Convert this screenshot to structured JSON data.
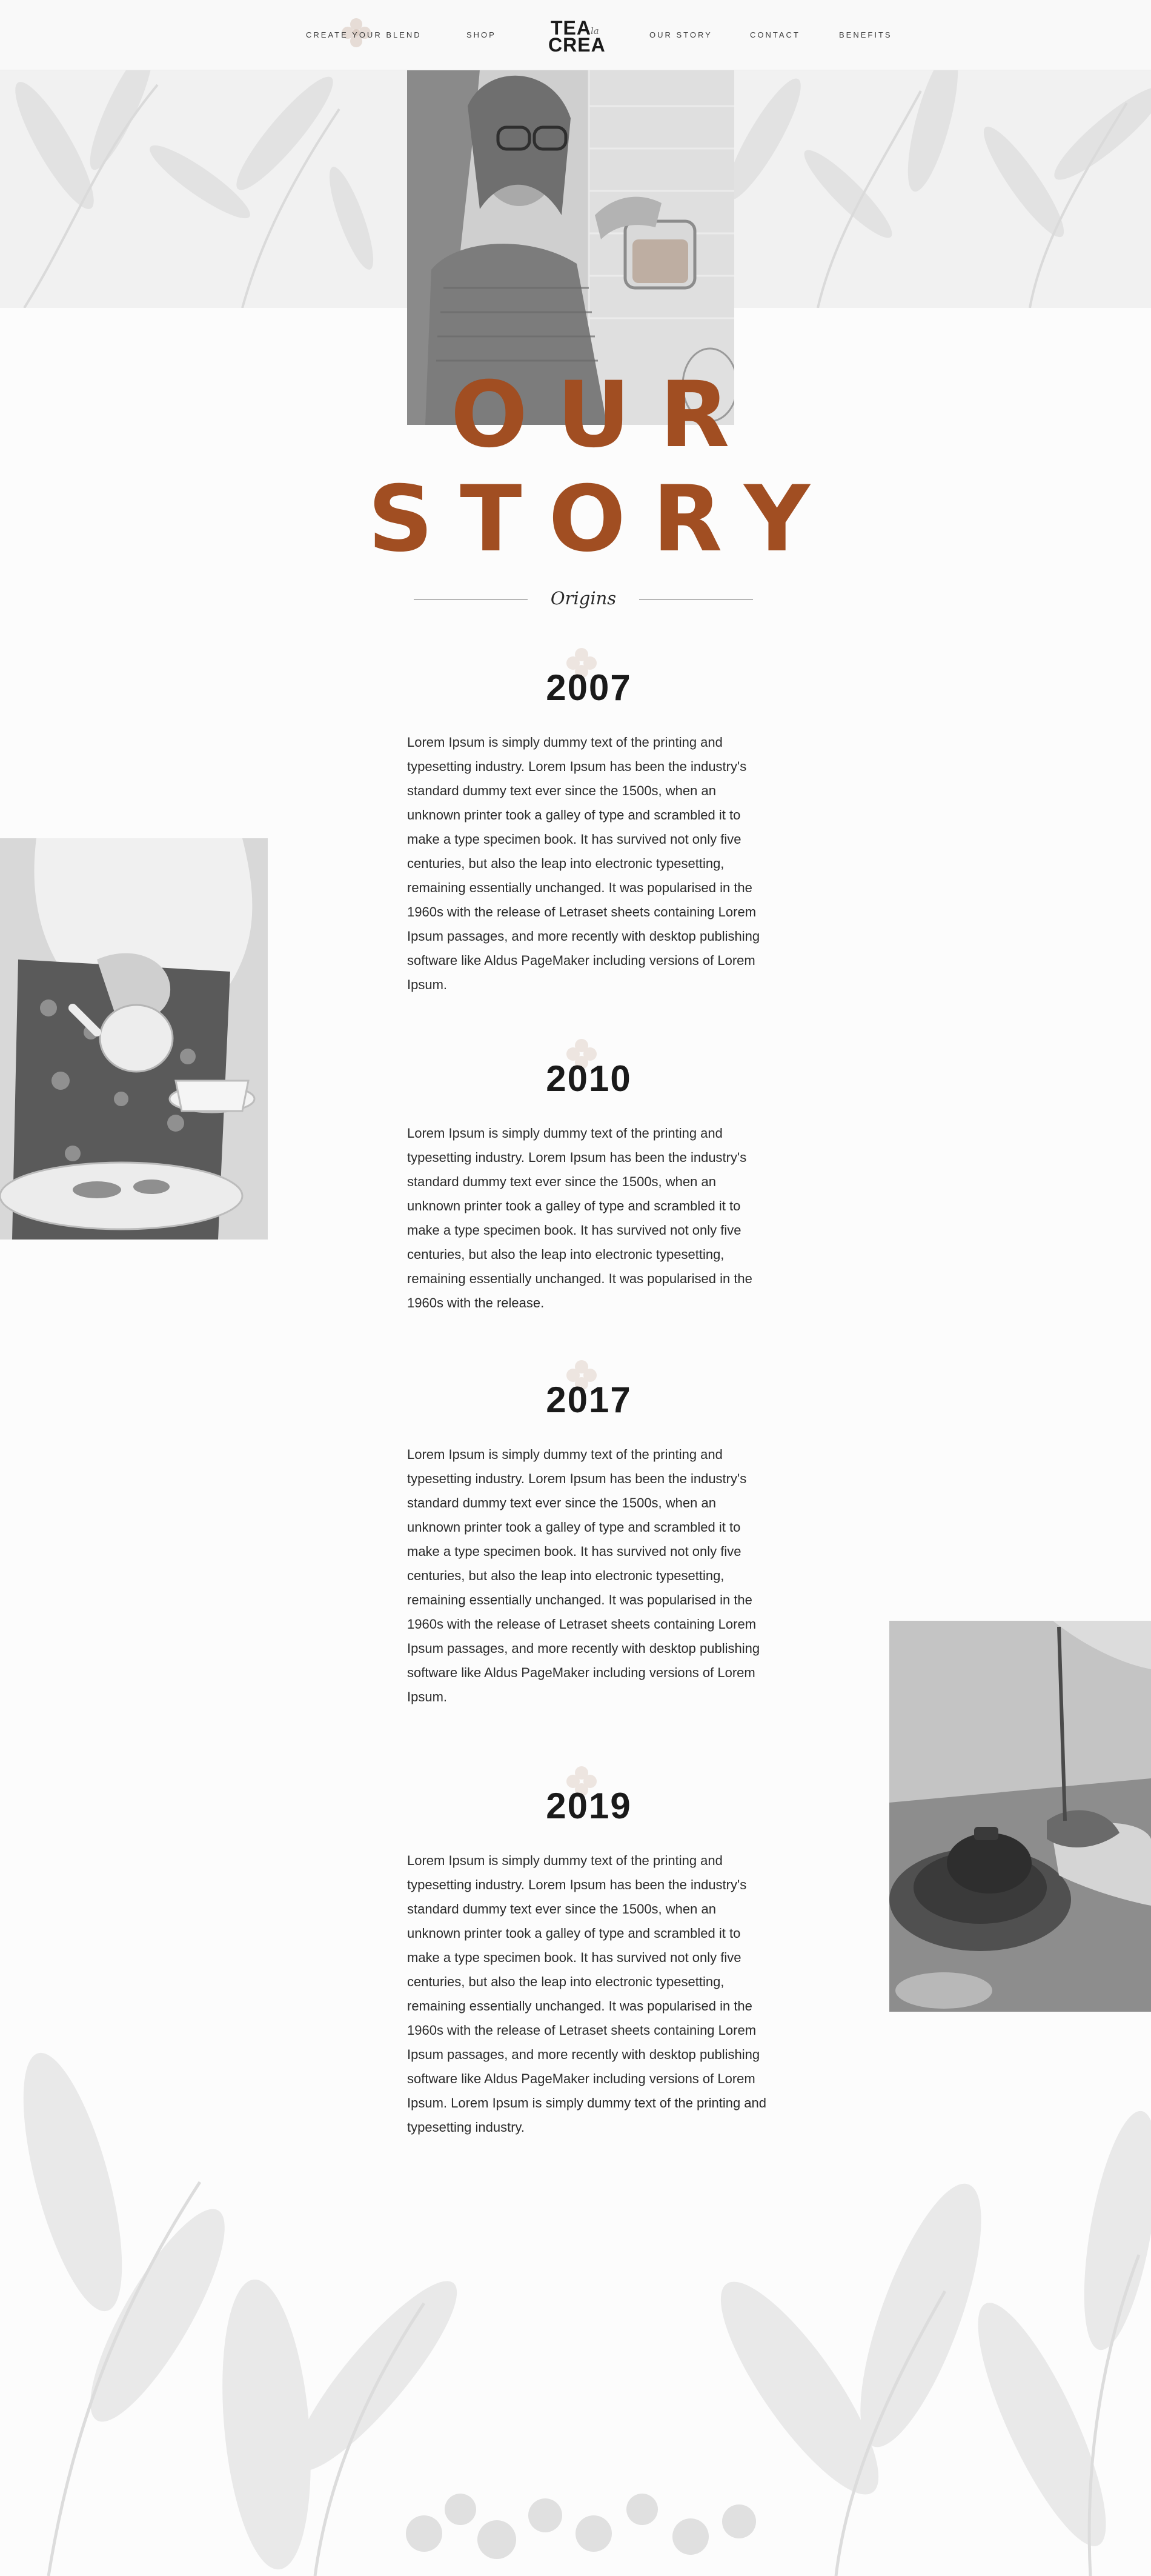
{
  "nav": {
    "left_links": [
      "CREATE YOUR BLEND",
      "SHOP"
    ],
    "right_links": [
      "OUR STORY",
      "CONTACT",
      "BENEFITS"
    ],
    "logo": {
      "line1": "TEA",
      "line2": "CREA",
      "accent": "la"
    }
  },
  "hero": {
    "title_line1": "OUR",
    "title_line2": "STORY",
    "subtitle": "Origins"
  },
  "timeline": [
    {
      "year": "2007",
      "text": "Lorem Ipsum is simply dummy text of the printing and typesetting industry. Lorem Ipsum has been the industry's standard dummy text ever since the 1500s, when an unknown printer took a galley of type and scrambled it to make a type specimen book. It has survived not only five centuries, but also the leap into electronic typesetting, remaining essentially unchanged. It was popularised in the 1960s with the release of Letraset sheets containing Lorem Ipsum passages, and more recently with desktop publishing software like Aldus PageMaker including versions of Lorem Ipsum."
    },
    {
      "year": "2010",
      "text": "Lorem Ipsum is simply dummy text of the printing and typesetting industry. Lorem Ipsum has been the industry's standard dummy text ever since the 1500s, when an unknown printer took a galley of type and scrambled it to make a type specimen book. It has survived not only five centuries, but also the leap into electronic typesetting, remaining essentially unchanged. It was popularised in the 1960s with the release."
    },
    {
      "year": "2017",
      "text": "Lorem Ipsum is simply dummy text of the printing and typesetting industry. Lorem Ipsum has been the industry's standard dummy text ever since the 1500s, when an unknown printer took a galley of type and scrambled it to make a type specimen book. It has survived not only five centuries, but also the leap into electronic typesetting, remaining essentially unchanged. It was popularised in the 1960s with the release of Letraset sheets containing Lorem Ipsum passages, and more recently with desktop publishing software like Aldus PageMaker including versions of Lorem Ipsum."
    },
    {
      "year": "2019",
      "text": "Lorem Ipsum is simply dummy text of the printing and typesetting industry. Lorem Ipsum has been the industry's standard dummy text ever since the 1500s, when an unknown printer took a galley of type and scrambled it to make a type specimen book. It has survived not only five centuries, but also the leap into electronic typesetting, remaining essentially unchanged. It was popularised in the 1960s with the release of Letraset sheets containing Lorem Ipsum passages, and more recently with desktop publishing software like Aldus PageMaker including versions of Lorem Ipsum. Lorem Ipsum is simply dummy text of the printing and typesetting industry."
    }
  ],
  "colors": {
    "accent": "#a14e22",
    "text": "#1e1e1e",
    "background": "#fcfcfc",
    "header_band": "#f1f1f1"
  },
  "icons": [
    "flower-ornament-icon",
    "leaf-pattern"
  ]
}
